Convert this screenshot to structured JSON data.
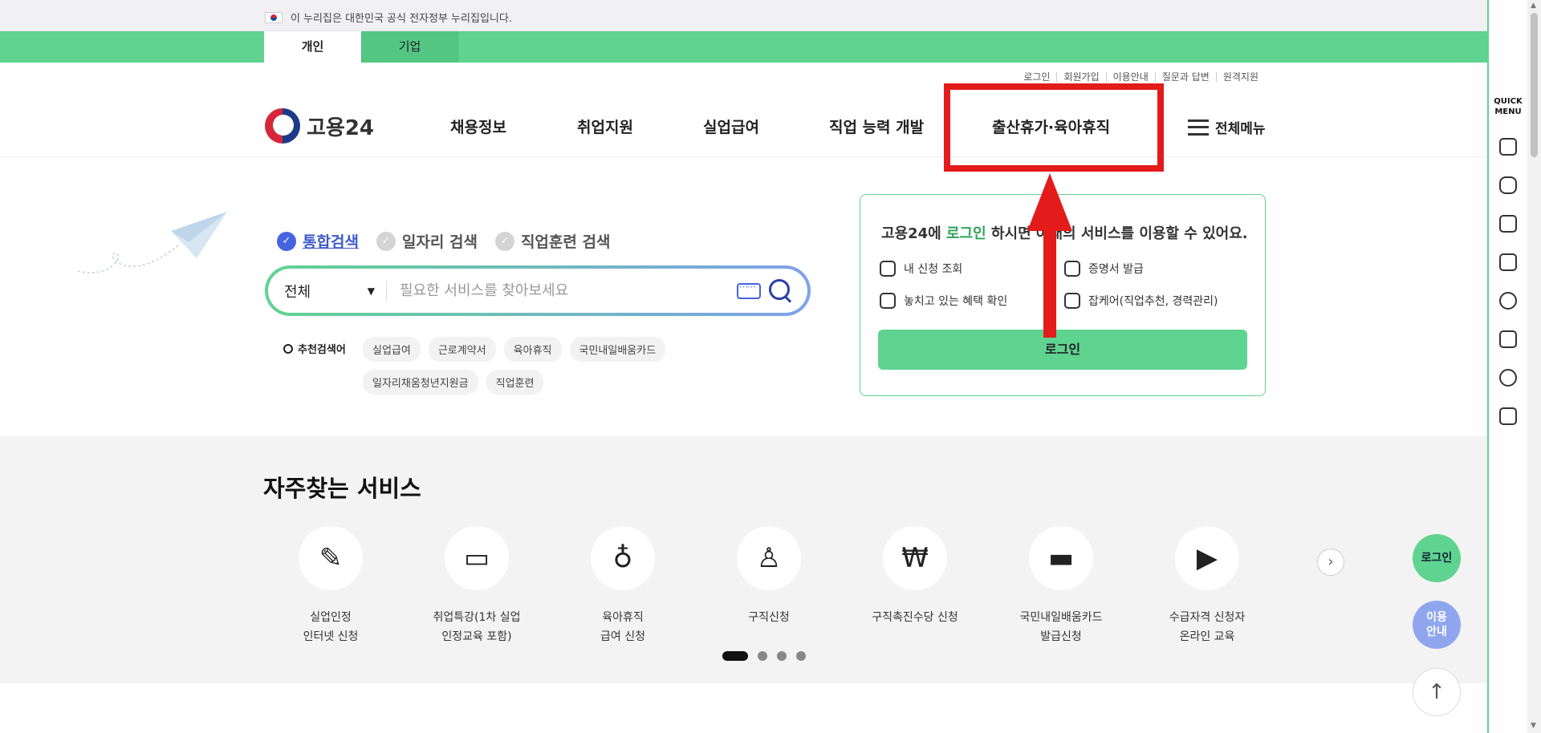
{
  "gov_banner": {
    "text": "이 누리집은 대한민국 공식 전자정부 누리집입니다."
  },
  "user_tabs": [
    {
      "label": "개인"
    },
    {
      "label": "기업"
    }
  ],
  "util_links": [
    "로그인",
    "회원가입",
    "이용안내",
    "질문과 답변",
    "원격지원"
  ],
  "logo": {
    "text": "고용24"
  },
  "gnb": [
    "채용정보",
    "취업지원",
    "실업급여",
    "직업 능력 개발",
    "출산휴가·육아휴직"
  ],
  "all_menu": {
    "label": "전체메뉴"
  },
  "search": {
    "tabs": [
      "통합검색",
      "일자리 검색",
      "직업훈련 검색"
    ],
    "active_tab": "통합검색",
    "category": "전체",
    "placeholder": "필요한 서비스를 찾아보세요",
    "reco_label": "추천검색어",
    "keywords": [
      "실업급여",
      "근로계약서",
      "육아휴직",
      "국민내일배움카드",
      "일자리채움청년지원금",
      "직업훈련"
    ]
  },
  "login_panel": {
    "title_prefix": "고용24에 ",
    "title_highlight": "로그인",
    "title_suffix": " 하시면 아래의 서비스를 이용할 수 있어요.",
    "items": [
      "내 신청 조회",
      "증명서 발급",
      "놓치고 있는 혜택 확인",
      "잡케어(직업추천, 경력관리)"
    ],
    "button": "로그인"
  },
  "services": {
    "title": "자주찾는 서비스",
    "items": [
      {
        "line1": "실업인정",
        "line2": "인터넷 신청",
        "icon": "document-pen-icon"
      },
      {
        "line1": "취업특강(1차 실업",
        "line2": "인정교육 포함)",
        "icon": "presentation-board-icon"
      },
      {
        "line1": "육아휴직",
        "line2": "급여 신청",
        "icon": "baby-bottle-icon"
      },
      {
        "line1": "구직신청",
        "line2": "",
        "icon": "person-pen-icon"
      },
      {
        "line1": "구직촉진수당 신청",
        "line2": "",
        "icon": "money-bag-icon"
      },
      {
        "line1": "국민내일배움카드",
        "line2": "발급신청",
        "icon": "card-icon"
      },
      {
        "line1": "수급자격 신청자",
        "line2": "온라인 교육",
        "icon": "monitor-play-icon"
      }
    ],
    "pagination": {
      "pages": 4,
      "current": 1
    }
  },
  "floating": {
    "login": "로그인",
    "guide_line1": "이용",
    "guide_line2": "안내"
  },
  "quick_menu": {
    "title_line1": "QUICK",
    "title_line2": "MENU",
    "icons": [
      "building-icon",
      "chat-icon",
      "monitor-icon",
      "checklist-icon",
      "smile-icon",
      "calculator-icon",
      "coins-icon",
      "printer-icon"
    ]
  },
  "colors": {
    "brand_green": "#5fd390",
    "annotation_red": "#e31b1b",
    "accent_blue": "#4664e0"
  }
}
